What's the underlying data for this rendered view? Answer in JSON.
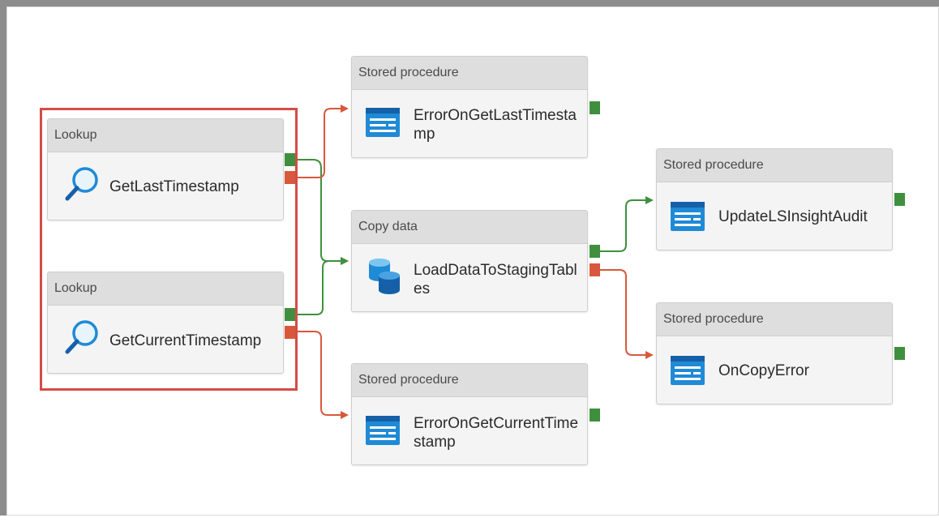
{
  "nodes": {
    "lookup_last": {
      "type": "Lookup",
      "name": "GetLastTimestamp"
    },
    "lookup_current": {
      "type": "Lookup",
      "name": "GetCurrentTimestamp"
    },
    "sp_error_last": {
      "type": "Stored procedure",
      "name": "ErrorOnGetLastTimestamp"
    },
    "copy_data": {
      "type": "Copy data",
      "name": "LoadDataToStagingTables"
    },
    "sp_error_current": {
      "type": "Stored procedure",
      "name": "ErrorOnGetCurrentTimestamp"
    },
    "sp_update_audit": {
      "type": "Stored procedure",
      "name": "UpdateLSInsightAudit"
    },
    "sp_on_copy_error": {
      "type": "Stored procedure",
      "name": "OnCopyError"
    }
  },
  "colors": {
    "success": "#3f8f3f",
    "failure": "#d8583d",
    "selection": "#d54c46",
    "icon_blue": "#1f8ad6"
  },
  "icons": {
    "lookup": "magnifier-icon",
    "stored_procedure": "stored-procedure-icon",
    "copy_data": "database-copy-icon"
  }
}
